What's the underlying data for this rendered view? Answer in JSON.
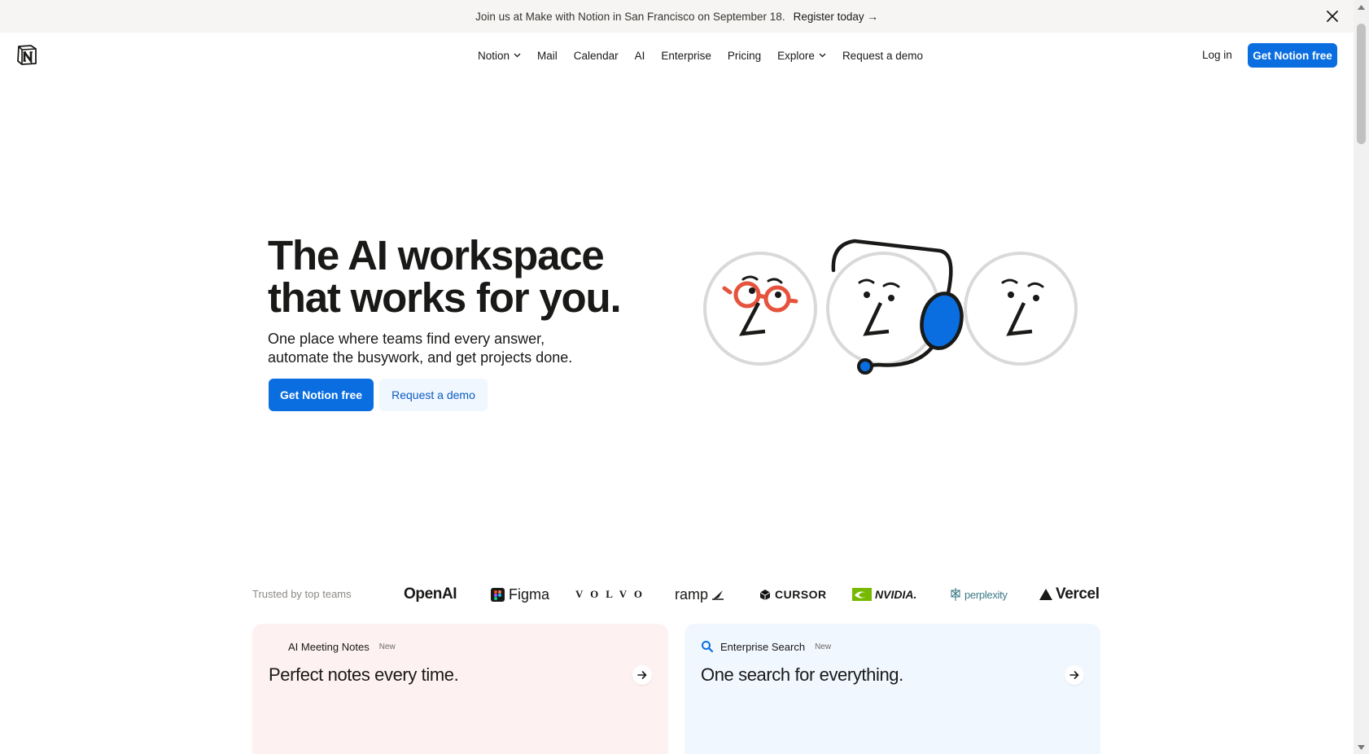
{
  "banner": {
    "text": "Join us at Make with Notion in San Francisco on September 18.",
    "link": "Register today →"
  },
  "nav": {
    "items": [
      {
        "label": "Notion",
        "dropdown": true
      },
      {
        "label": "Mail",
        "dropdown": false
      },
      {
        "label": "Calendar",
        "dropdown": false
      },
      {
        "label": "AI",
        "dropdown": false
      },
      {
        "label": "Enterprise",
        "dropdown": false
      },
      {
        "label": "Pricing",
        "dropdown": false
      },
      {
        "label": "Explore",
        "dropdown": true
      },
      {
        "label": "Request a demo",
        "dropdown": false
      }
    ],
    "login": "Log in",
    "cta": "Get Notion free"
  },
  "hero": {
    "title_line1": "The AI workspace",
    "title_line2": "that works for you.",
    "subtitle_line1": "One place where teams find every answer,",
    "subtitle_line2": "automate the busywork, and get projects done.",
    "primary_cta": "Get Notion free",
    "secondary_cta": "Request a demo"
  },
  "trusted": {
    "label": "Trusted by top teams",
    "logos": [
      "OpenAI",
      "Figma",
      "VOLVO",
      "ramp",
      "CURSOR",
      "NVIDIA.",
      "perplexity",
      "Vercel"
    ]
  },
  "cards": [
    {
      "tag": "AI Meeting Notes",
      "badge": "New",
      "title": "Perfect notes every time."
    },
    {
      "tag": "Enterprise Search",
      "badge": "New",
      "title": "One search for everything."
    }
  ],
  "colors": {
    "accent": "#0a6ee0",
    "banner_bg": "#f6f5f4",
    "card1_bg": "#fdf2f1",
    "card2_bg": "#f1f7fe",
    "glasses": "#e5533d",
    "headset": "#0a6ee0"
  }
}
